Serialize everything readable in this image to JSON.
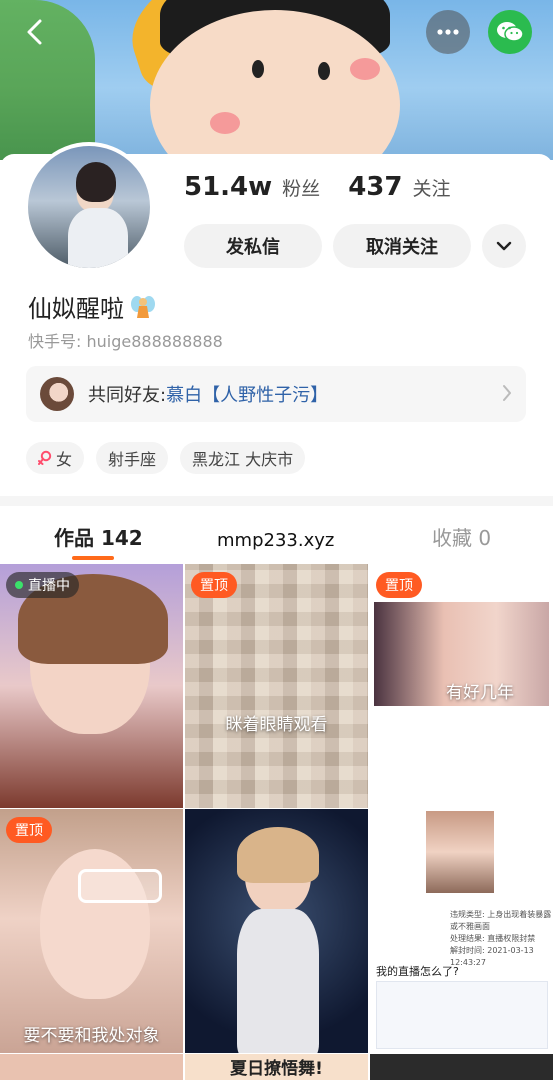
{
  "header": {
    "back_icon": "chevron-left-icon",
    "more_icon": "more-dots-icon",
    "share_icon": "wechat-icon"
  },
  "profile": {
    "followers_count": "51.4w",
    "followers_label": "粉丝",
    "following_count": "437",
    "following_label": "关注",
    "message_button": "发私信",
    "unfollow_button": "取消关注",
    "nickname": "仙姒醒啦",
    "kwai_id": "快手号: huige888888888",
    "mutual_label": "共同好友: ",
    "mutual_name": "慕白【人野性子污】",
    "tags": [
      {
        "icon": "female-icon",
        "label": "女"
      },
      {
        "label": "射手座"
      },
      {
        "label": "黑龙江 大庆市"
      }
    ]
  },
  "tabs": {
    "works": "作品 142",
    "favorites": "收藏 0",
    "watermark": "mmp233.xyz"
  },
  "grid": {
    "items": [
      {
        "badge": "直播中"
      },
      {
        "badge": "置顶",
        "caption": "眯着眼睛观看"
      },
      {
        "badge": "置顶",
        "caption": "有好几年"
      },
      {
        "badge": "置顶",
        "caption": "要不要和我处对象"
      },
      {},
      {
        "info_1": "违规类型:",
        "info_1_value": "上身出现着装暴露或不雅画面",
        "info_2": "处理结果:",
        "info_2_value": "直播权限封禁",
        "info_3": "解封时间:",
        "info_3_value": "2021-03-13 12:43:27",
        "question": "我的直播怎么了?"
      }
    ],
    "partial_caption": "夏日撩悟舞!"
  },
  "colors": {
    "accent": "#ff6a1a",
    "badge": "#ff5a22",
    "link": "#2f62a8",
    "wechat": "#2bbb4f"
  }
}
